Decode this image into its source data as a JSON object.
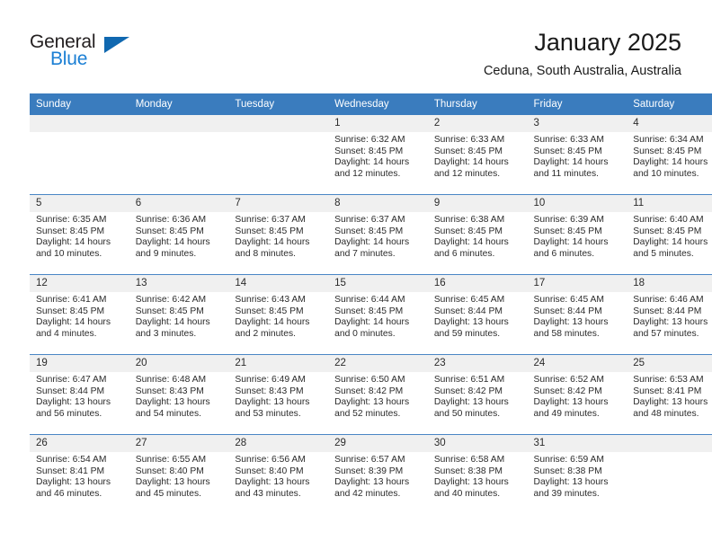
{
  "brand": {
    "name_part1": "General",
    "name_part2": "Blue",
    "accent_color": "#1b7fd4",
    "triangle_color": "#1068b0"
  },
  "header": {
    "title": "January 2025",
    "location": "Ceduna, South Australia, Australia"
  },
  "calendar": {
    "header_bg": "#3a7cbe",
    "daynum_bg": "#f0f0f0",
    "row_border": "#4a86c5",
    "weekday_headers": [
      "Sunday",
      "Monday",
      "Tuesday",
      "Wednesday",
      "Thursday",
      "Friday",
      "Saturday"
    ],
    "labels": {
      "sunrise": "Sunrise:",
      "sunset": "Sunset:",
      "daylight": "Daylight:"
    },
    "weeks": [
      [
        {
          "day": "",
          "empty": true
        },
        {
          "day": "",
          "empty": true
        },
        {
          "day": "",
          "empty": true
        },
        {
          "day": "1",
          "sunrise": "Sunrise: 6:32 AM",
          "sunset": "Sunset: 8:45 PM",
          "daylight": "Daylight: 14 hours and 12 minutes."
        },
        {
          "day": "2",
          "sunrise": "Sunrise: 6:33 AM",
          "sunset": "Sunset: 8:45 PM",
          "daylight": "Daylight: 14 hours and 12 minutes."
        },
        {
          "day": "3",
          "sunrise": "Sunrise: 6:33 AM",
          "sunset": "Sunset: 8:45 PM",
          "daylight": "Daylight: 14 hours and 11 minutes."
        },
        {
          "day": "4",
          "sunrise": "Sunrise: 6:34 AM",
          "sunset": "Sunset: 8:45 PM",
          "daylight": "Daylight: 14 hours and 10 minutes."
        }
      ],
      [
        {
          "day": "5",
          "sunrise": "Sunrise: 6:35 AM",
          "sunset": "Sunset: 8:45 PM",
          "daylight": "Daylight: 14 hours and 10 minutes."
        },
        {
          "day": "6",
          "sunrise": "Sunrise: 6:36 AM",
          "sunset": "Sunset: 8:45 PM",
          "daylight": "Daylight: 14 hours and 9 minutes."
        },
        {
          "day": "7",
          "sunrise": "Sunrise: 6:37 AM",
          "sunset": "Sunset: 8:45 PM",
          "daylight": "Daylight: 14 hours and 8 minutes."
        },
        {
          "day": "8",
          "sunrise": "Sunrise: 6:37 AM",
          "sunset": "Sunset: 8:45 PM",
          "daylight": "Daylight: 14 hours and 7 minutes."
        },
        {
          "day": "9",
          "sunrise": "Sunrise: 6:38 AM",
          "sunset": "Sunset: 8:45 PM",
          "daylight": "Daylight: 14 hours and 6 minutes."
        },
        {
          "day": "10",
          "sunrise": "Sunrise: 6:39 AM",
          "sunset": "Sunset: 8:45 PM",
          "daylight": "Daylight: 14 hours and 6 minutes."
        },
        {
          "day": "11",
          "sunrise": "Sunrise: 6:40 AM",
          "sunset": "Sunset: 8:45 PM",
          "daylight": "Daylight: 14 hours and 5 minutes."
        }
      ],
      [
        {
          "day": "12",
          "sunrise": "Sunrise: 6:41 AM",
          "sunset": "Sunset: 8:45 PM",
          "daylight": "Daylight: 14 hours and 4 minutes."
        },
        {
          "day": "13",
          "sunrise": "Sunrise: 6:42 AM",
          "sunset": "Sunset: 8:45 PM",
          "daylight": "Daylight: 14 hours and 3 minutes."
        },
        {
          "day": "14",
          "sunrise": "Sunrise: 6:43 AM",
          "sunset": "Sunset: 8:45 PM",
          "daylight": "Daylight: 14 hours and 2 minutes."
        },
        {
          "day": "15",
          "sunrise": "Sunrise: 6:44 AM",
          "sunset": "Sunset: 8:45 PM",
          "daylight": "Daylight: 14 hours and 0 minutes."
        },
        {
          "day": "16",
          "sunrise": "Sunrise: 6:45 AM",
          "sunset": "Sunset: 8:44 PM",
          "daylight": "Daylight: 13 hours and 59 minutes."
        },
        {
          "day": "17",
          "sunrise": "Sunrise: 6:45 AM",
          "sunset": "Sunset: 8:44 PM",
          "daylight": "Daylight: 13 hours and 58 minutes."
        },
        {
          "day": "18",
          "sunrise": "Sunrise: 6:46 AM",
          "sunset": "Sunset: 8:44 PM",
          "daylight": "Daylight: 13 hours and 57 minutes."
        }
      ],
      [
        {
          "day": "19",
          "sunrise": "Sunrise: 6:47 AM",
          "sunset": "Sunset: 8:44 PM",
          "daylight": "Daylight: 13 hours and 56 minutes."
        },
        {
          "day": "20",
          "sunrise": "Sunrise: 6:48 AM",
          "sunset": "Sunset: 8:43 PM",
          "daylight": "Daylight: 13 hours and 54 minutes."
        },
        {
          "day": "21",
          "sunrise": "Sunrise: 6:49 AM",
          "sunset": "Sunset: 8:43 PM",
          "daylight": "Daylight: 13 hours and 53 minutes."
        },
        {
          "day": "22",
          "sunrise": "Sunrise: 6:50 AM",
          "sunset": "Sunset: 8:42 PM",
          "daylight": "Daylight: 13 hours and 52 minutes."
        },
        {
          "day": "23",
          "sunrise": "Sunrise: 6:51 AM",
          "sunset": "Sunset: 8:42 PM",
          "daylight": "Daylight: 13 hours and 50 minutes."
        },
        {
          "day": "24",
          "sunrise": "Sunrise: 6:52 AM",
          "sunset": "Sunset: 8:42 PM",
          "daylight": "Daylight: 13 hours and 49 minutes."
        },
        {
          "day": "25",
          "sunrise": "Sunrise: 6:53 AM",
          "sunset": "Sunset: 8:41 PM",
          "daylight": "Daylight: 13 hours and 48 minutes."
        }
      ],
      [
        {
          "day": "26",
          "sunrise": "Sunrise: 6:54 AM",
          "sunset": "Sunset: 8:41 PM",
          "daylight": "Daylight: 13 hours and 46 minutes."
        },
        {
          "day": "27",
          "sunrise": "Sunrise: 6:55 AM",
          "sunset": "Sunset: 8:40 PM",
          "daylight": "Daylight: 13 hours and 45 minutes."
        },
        {
          "day": "28",
          "sunrise": "Sunrise: 6:56 AM",
          "sunset": "Sunset: 8:40 PM",
          "daylight": "Daylight: 13 hours and 43 minutes."
        },
        {
          "day": "29",
          "sunrise": "Sunrise: 6:57 AM",
          "sunset": "Sunset: 8:39 PM",
          "daylight": "Daylight: 13 hours and 42 minutes."
        },
        {
          "day": "30",
          "sunrise": "Sunrise: 6:58 AM",
          "sunset": "Sunset: 8:38 PM",
          "daylight": "Daylight: 13 hours and 40 minutes."
        },
        {
          "day": "31",
          "sunrise": "Sunrise: 6:59 AM",
          "sunset": "Sunset: 8:38 PM",
          "daylight": "Daylight: 13 hours and 39 minutes."
        },
        {
          "day": "",
          "empty": true
        }
      ]
    ]
  }
}
